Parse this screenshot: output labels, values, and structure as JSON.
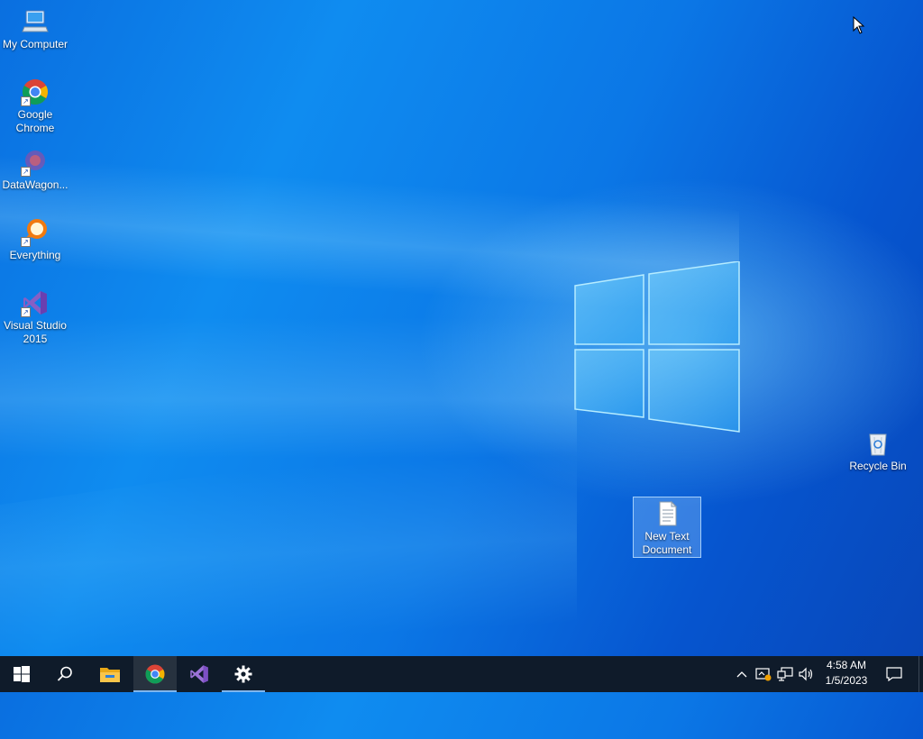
{
  "desktop": {
    "icons": [
      {
        "label": "My Computer",
        "icon": "computer-icon"
      },
      {
        "label": "Google Chrome",
        "icon": "chrome-icon"
      },
      {
        "label": "DataWagon...",
        "icon": "datawagon-icon"
      },
      {
        "label": "Everything",
        "icon": "everything-search-icon"
      },
      {
        "label": "Visual Studio 2015",
        "icon": "visual-studio-icon"
      },
      {
        "label": "Recycle Bin",
        "icon": "recycle-bin-icon"
      },
      {
        "label": "New Text Document",
        "icon": "text-document-icon",
        "selected": true
      }
    ]
  },
  "taskbar": {
    "items": [
      {
        "name": "start",
        "icon": "windows-start-icon"
      },
      {
        "name": "search",
        "icon": "search-icon"
      },
      {
        "name": "file-explorer",
        "icon": "folder-icon"
      },
      {
        "name": "chrome",
        "icon": "chrome-icon",
        "running": true
      },
      {
        "name": "visual-studio",
        "icon": "visual-studio-icon"
      },
      {
        "name": "settings",
        "icon": "gear-icon",
        "running": true
      }
    ],
    "tray": {
      "icons": [
        "chevron-up-icon",
        "security-warning-icon",
        "network-icon",
        "volume-icon"
      ],
      "time": "4:58 AM",
      "date": "1/5/2023",
      "notification_icon": "notification-icon"
    }
  },
  "colors": {
    "taskbar": "#0f1b2a",
    "desktop_accent": "#0b77e6"
  }
}
